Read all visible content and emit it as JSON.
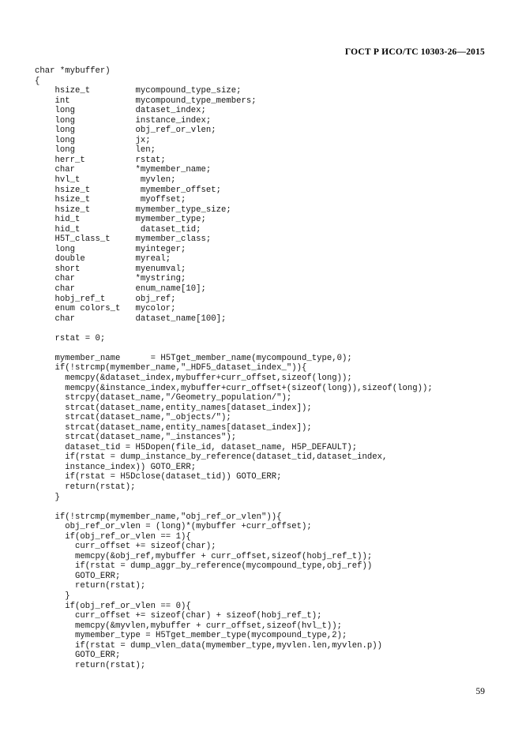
{
  "document": {
    "standard_header": "ГОСТ Р ИСО/ТС 10303-26—2015",
    "page_number": "59"
  },
  "code_listing": {
    "language": "c",
    "lines": [
      "char *mybuffer)",
      "{",
      "    hsize_t         mycompound_type_size;",
      "    int             mycompound_type_members;",
      "    long            dataset_index;",
      "    long            instance_index;",
      "    long            obj_ref_or_vlen;",
      "    long            jx;",
      "    long            len;",
      "    herr_t          rstat;",
      "    char            *mymember_name;",
      "    hvl_t            myvlen;",
      "    hsize_t          mymember_offset;",
      "    hsize_t          myoffset;",
      "    hsize_t         mymember_type_size;",
      "    hid_t           mymember_type;",
      "    hid_t            dataset_tid;",
      "    H5T_class_t     mymember_class;",
      "    long            myinteger;",
      "    double          myreal;",
      "    short           myenumval;",
      "    char            *mystring;",
      "    char            enum_name[10];",
      "    hobj_ref_t      obj_ref;",
      "    enum colors_t   mycolor;",
      "    char            dataset_name[100];",
      "",
      "    rstat = 0;",
      "",
      "    mymember_name      = H5Tget_member_name(mycompound_type,0);",
      "    if(!strcmp(mymember_name,\"_HDF5_dataset_index_\")){",
      "      memcpy(&dataset_index,mybuffer+curr_offset,sizeof(long));",
      "      memcpy(&instance_index,mybuffer+curr_offset+(sizeof(long)),sizeof(long));",
      "      strcpy(dataset_name,\"/Geometry_population/\");",
      "      strcat(dataset_name,entity_names[dataset_index]);",
      "      strcat(dataset_name,\"_objects/\");",
      "      strcat(dataset_name,entity_names[dataset_index]);",
      "      strcat(dataset_name,\"_instances\");",
      "      dataset_tid = H5Dopen(file_id, dataset_name, H5P_DEFAULT);",
      "      if(rstat = dump_instance_by_reference(dataset_tid,dataset_index,",
      "      instance_index)) GOTO_ERR;",
      "      if(rstat = H5Dclose(dataset_tid)) GOTO_ERR;",
      "      return(rstat);",
      "    }",
      "",
      "    if(!strcmp(mymember_name,\"obj_ref_or_vlen\")){",
      "      obj_ref_or_vlen = (long)*(mybuffer +curr_offset);",
      "      if(obj_ref_or_vlen == 1){",
      "        curr_offset += sizeof(char);",
      "        memcpy(&obj_ref,mybuffer + curr_offset,sizeof(hobj_ref_t));",
      "        if(rstat = dump_aggr_by_reference(mycompound_type,obj_ref))",
      "        GOTO_ERR;",
      "        return(rstat);",
      "      }",
      "      if(obj_ref_or_vlen == 0){",
      "        curr_offset += sizeof(char) + sizeof(hobj_ref_t);",
      "        memcpy(&myvlen,mybuffer + curr_offset,sizeof(hvl_t));",
      "        mymember_type = H5Tget_member_type(mycompound_type,2);",
      "        if(rstat = dump_vlen_data(mymember_type,myvlen.len,myvlen.p))",
      "        GOTO_ERR;",
      "        return(rstat);"
    ]
  }
}
